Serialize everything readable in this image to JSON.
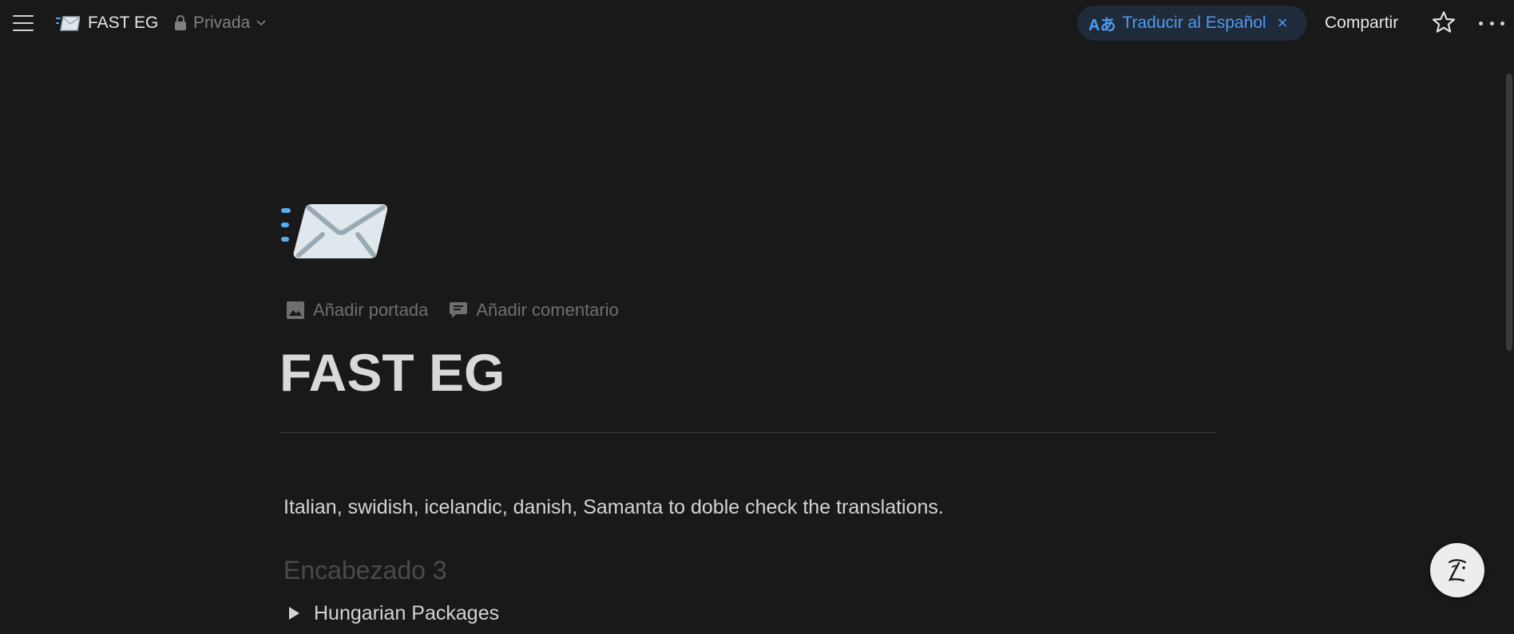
{
  "topbar": {
    "menu_icon": "hamburger-menu-icon",
    "page_icon": "incoming-envelope-emoji",
    "page_title": "FAST EG",
    "privacy_icon": "lock-icon",
    "privacy_label": "Privada",
    "privacy_chevron": "chevron-down-icon",
    "translate": {
      "icon": "translate-icon",
      "icon_text": "Aあ",
      "label": "Traducir al Español",
      "close": "×"
    },
    "share_label": "Compartir",
    "favorite_icon": "star-outline-icon",
    "more_icon": "more-horizontal-icon"
  },
  "page": {
    "icon": "incoming-envelope-emoji",
    "actions": [
      {
        "icon": "image-icon",
        "label": "Añadir portada"
      },
      {
        "icon": "comment-icon",
        "label": "Añadir comentario"
      }
    ],
    "title": "FAST EG",
    "paragraph": "Italian, swidish, icelandic, danish, Samanta to doble check the translations.",
    "heading3_placeholder": "Encabezado 3",
    "toggle": {
      "label": "Hungarian Packages",
      "state": "collapsed"
    }
  },
  "help_button": {
    "icon": "help-face-icon"
  },
  "colors": {
    "background": "#191919",
    "text": "#d4d4d4",
    "muted": "#6f6f6f",
    "accent_blue": "#4d9cf0",
    "translate_pill_bg": "#1f2a3a"
  }
}
